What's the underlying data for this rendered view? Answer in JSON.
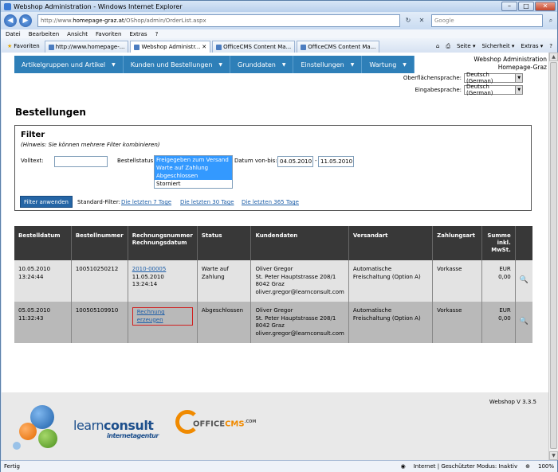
{
  "browser": {
    "window_title": "Webshop Administration - Windows Internet Explorer",
    "address_prefix": "http://www.",
    "address_domain": "homepage-graz.at",
    "address_path": "/OShop/admin/OrderList.aspx",
    "search_placeholder": "Google",
    "menu": [
      "Datei",
      "Bearbeiten",
      "Ansicht",
      "Favoriten",
      "Extras",
      "?"
    ],
    "favorites_label": "Favoriten",
    "tabs": [
      {
        "label": "http://www.homepage-..."
      },
      {
        "label": "Webshop Administr..."
      },
      {
        "label": "OfficeCMS Content Ma..."
      },
      {
        "label": "OfficeCMS Content Ma..."
      }
    ],
    "tools": [
      "Seite",
      "Sicherheit",
      "Extras"
    ],
    "status_left": "Fertig",
    "status_zone": "Internet | Geschützter Modus: Inaktiv",
    "zoom": "100%"
  },
  "nav": {
    "items": [
      {
        "label": "Artikelgruppen und Artikel"
      },
      {
        "label": "Kunden und Bestellungen"
      },
      {
        "label": "Grunddaten"
      },
      {
        "label": "Einstellungen"
      },
      {
        "label": "Wartung"
      }
    ]
  },
  "shop": {
    "title": "Webshop Administration",
    "site": "Homepage-Graz",
    "ui_lang_label": "Oberflächensprache:",
    "ui_lang_value": "Deutsch (German)",
    "input_lang_label": "Eingabesprache:",
    "input_lang_value": "Deutsch (German)"
  },
  "page": {
    "title": "Bestellungen"
  },
  "filter": {
    "title": "Filter",
    "hint": "(Hinweis: Sie können mehrere Filter kombinieren)",
    "freetext_label": "Volltext:",
    "freetext_value": "",
    "status_label": "Bestellstatus:",
    "status_options": [
      "Freigegeben zum Versand",
      "Warte auf Zahlung",
      "Abgeschlossen",
      "Storniert"
    ],
    "date_label": "Datum von-bis:",
    "date_from": "04.05.2010",
    "date_sep": "-",
    "date_to": "11.05.2010",
    "apply_button": "Filter anwenden",
    "std_label": "Standard-Filter:",
    "std_links": [
      "Die letzten 7 Tage",
      "Die letzten 30 Tage",
      "Die letzten 365 Tage"
    ]
  },
  "table": {
    "headers": {
      "date": "Bestelldatum",
      "number": "Bestellnummer",
      "invoice": "Rechnungsnummer Rechnungsdatum",
      "status": "Status",
      "customer": "Kundendaten",
      "shipping": "Versandart",
      "payment": "Zahlungsart",
      "sum": "Summe inkl. MwSt."
    },
    "rows": [
      {
        "date": "10.05.2010",
        "time": "13:24:44",
        "number": "100510250212",
        "invoice_link": "2010-00005",
        "invoice_date": "11.05.2010",
        "invoice_time": "13:24:14",
        "status": "Warte auf Zahlung",
        "c_name": "Oliver Gregor",
        "c_street": "St. Peter Hauptstrasse 208/1",
        "c_city": "8042 Graz",
        "c_email": "oliver.gregor@learnconsult.com",
        "shipping": "Automatische Freischaltung (Option A)",
        "payment": "Vorkasse",
        "sum": "EUR 0,00"
      },
      {
        "date": "05.05.2010",
        "time": "11:32:43",
        "number": "100505109910",
        "invoice_link": "Rechnung erzeugen",
        "status": "Abgeschlossen",
        "c_name": "Oliver Gregor",
        "c_street": "St. Peter Hauptstrasse 208/1",
        "c_city": "8042 Graz",
        "c_email": "oliver.gregor@learnconsult.com",
        "shipping": "Automatische Freischaltung (Option A)",
        "payment": "Vorkasse",
        "sum": "EUR 0,00"
      }
    ]
  },
  "footer": {
    "version": "Webshop V 3.3.5",
    "brand_learn": "learn",
    "brand_consult": "consult",
    "brand_sub": "internetagentur",
    "brand_office": "OFFICE",
    "brand_cms": "CMS",
    "brand_com": ".COM"
  },
  "colors": {
    "nav": "#2e7fb8",
    "header": "#383838",
    "row1": "#e3e3e3",
    "row2": "#b9b9b9",
    "link": "#1d5ea8"
  }
}
